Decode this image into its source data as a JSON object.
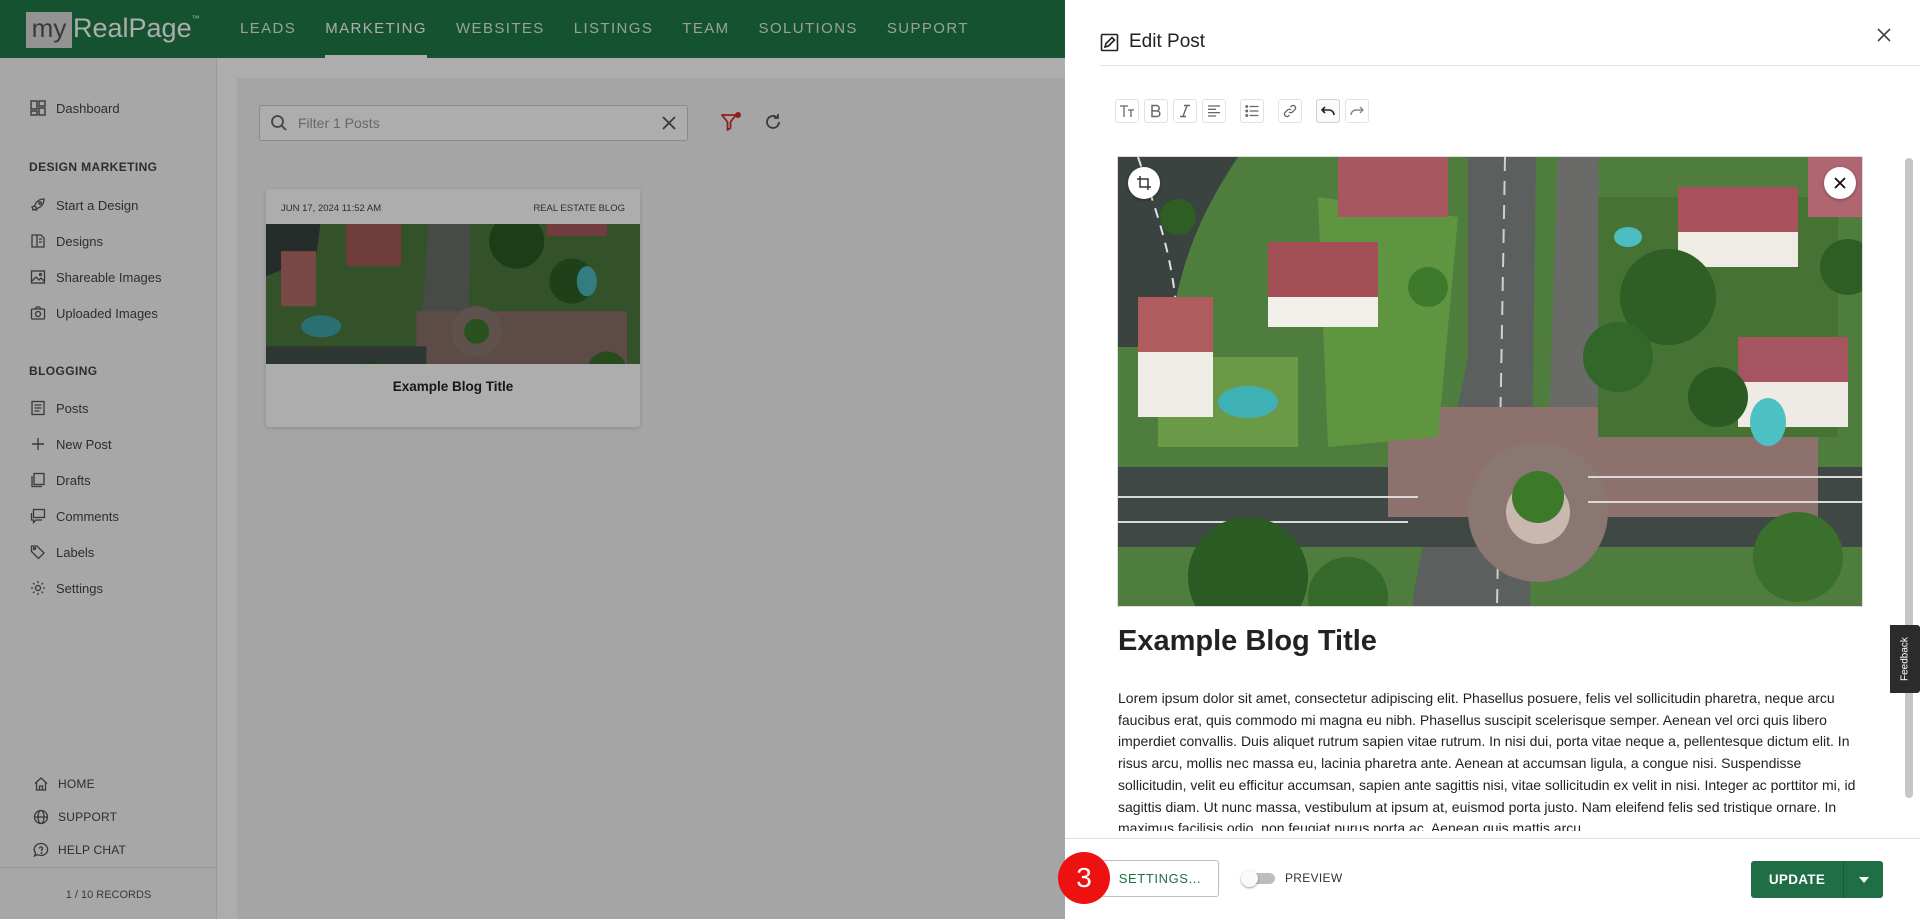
{
  "brand": {
    "logo_prefix": "my",
    "logo_name": "RealPage",
    "logo_tm": "™"
  },
  "nav": {
    "items": [
      {
        "label": "LEADS"
      },
      {
        "label": "MARKETING",
        "active": true
      },
      {
        "label": "WEBSITES"
      },
      {
        "label": "LISTINGS"
      },
      {
        "label": "TEAM"
      },
      {
        "label": "SOLUTIONS"
      },
      {
        "label": "SUPPORT"
      }
    ]
  },
  "sidebar": {
    "dashboard": {
      "label": "Dashboard",
      "icon": "dashboard-icon"
    },
    "design_heading": "DESIGN MARKETING",
    "design_items": [
      {
        "label": "Start a Design",
        "icon": "rocket-icon"
      },
      {
        "label": "Designs",
        "icon": "book-icon"
      },
      {
        "label": "Shareable Images",
        "icon": "image-icon"
      },
      {
        "label": "Uploaded Images",
        "icon": "camera-icon"
      }
    ],
    "blogging_heading": "BLOGGING",
    "blog_items": [
      {
        "label": "Posts",
        "icon": "posts-icon"
      },
      {
        "label": "New Post",
        "icon": "plus-icon"
      },
      {
        "label": "Drafts",
        "icon": "drafts-icon"
      },
      {
        "label": "Comments",
        "icon": "comments-icon"
      },
      {
        "label": "Labels",
        "icon": "tags-icon"
      },
      {
        "label": "Settings",
        "icon": "gear-icon"
      }
    ],
    "bottom_items": [
      {
        "label": "HOME",
        "icon": "home-icon"
      },
      {
        "label": "SUPPORT",
        "icon": "globe-icon"
      },
      {
        "label": "HELP CHAT",
        "icon": "chat-icon"
      }
    ],
    "records": "1 / 10 RECORDS"
  },
  "main": {
    "filter_placeholder": "Filter 1 Posts",
    "card": {
      "date": "JUN 17, 2024 11:52 AM",
      "label": "REAL ESTATE BLOG",
      "title": "Example Blog Title"
    }
  },
  "drawer": {
    "title": "Edit Post",
    "post_title": "Example Blog Title",
    "post_body": "Lorem ipsum dolor sit amet, consectetur adipiscing elit. Phasellus posuere, felis vel sollicitudin pharetra, neque arcu faucibus erat, quis commodo mi magna eu nibh. Phasellus suscipit scelerisque semper. Aenean vel orci quis libero imperdiet convallis. Duis aliquet rutrum sapien vitae rutrum. In nisi dui, porta vitae neque a, pellentesque dictum elit. In risus arcu, mollis nec massa eu, lacinia pharetra ante. Aenean at accumsan ligula, a congue nisi. Suspendisse sollicitudin, velit eu efficitur accumsan, sapien ante sagittis nisi, vitae sollicitudin ex velit in nisi. Integer ac porttitor mi, id sagittis diam. Ut nunc massa, vestibulum at ipsum at, euismod porta justo. Nam eleifend felis sed tristique ornare. In maximus facilisis odio, non feugiat purus porta ac. Aenean quis mattis arcu.",
    "toolbar_icons": [
      "text-size-icon",
      "bold-icon",
      "italic-icon",
      "align-left-icon",
      "list-icon",
      "link-icon",
      "undo-icon",
      "redo-icon"
    ]
  },
  "footer": {
    "step_badge": "3",
    "settings_label": "SETTINGS...",
    "preview_label": "PREVIEW",
    "update_label": "UPDATE"
  },
  "feedback_label": "Feedback",
  "colors": {
    "brand_green": "#1f7a46",
    "button_green": "#1f6e45",
    "badge_red": "#e11111",
    "filter_accent": "#d32f2f"
  }
}
